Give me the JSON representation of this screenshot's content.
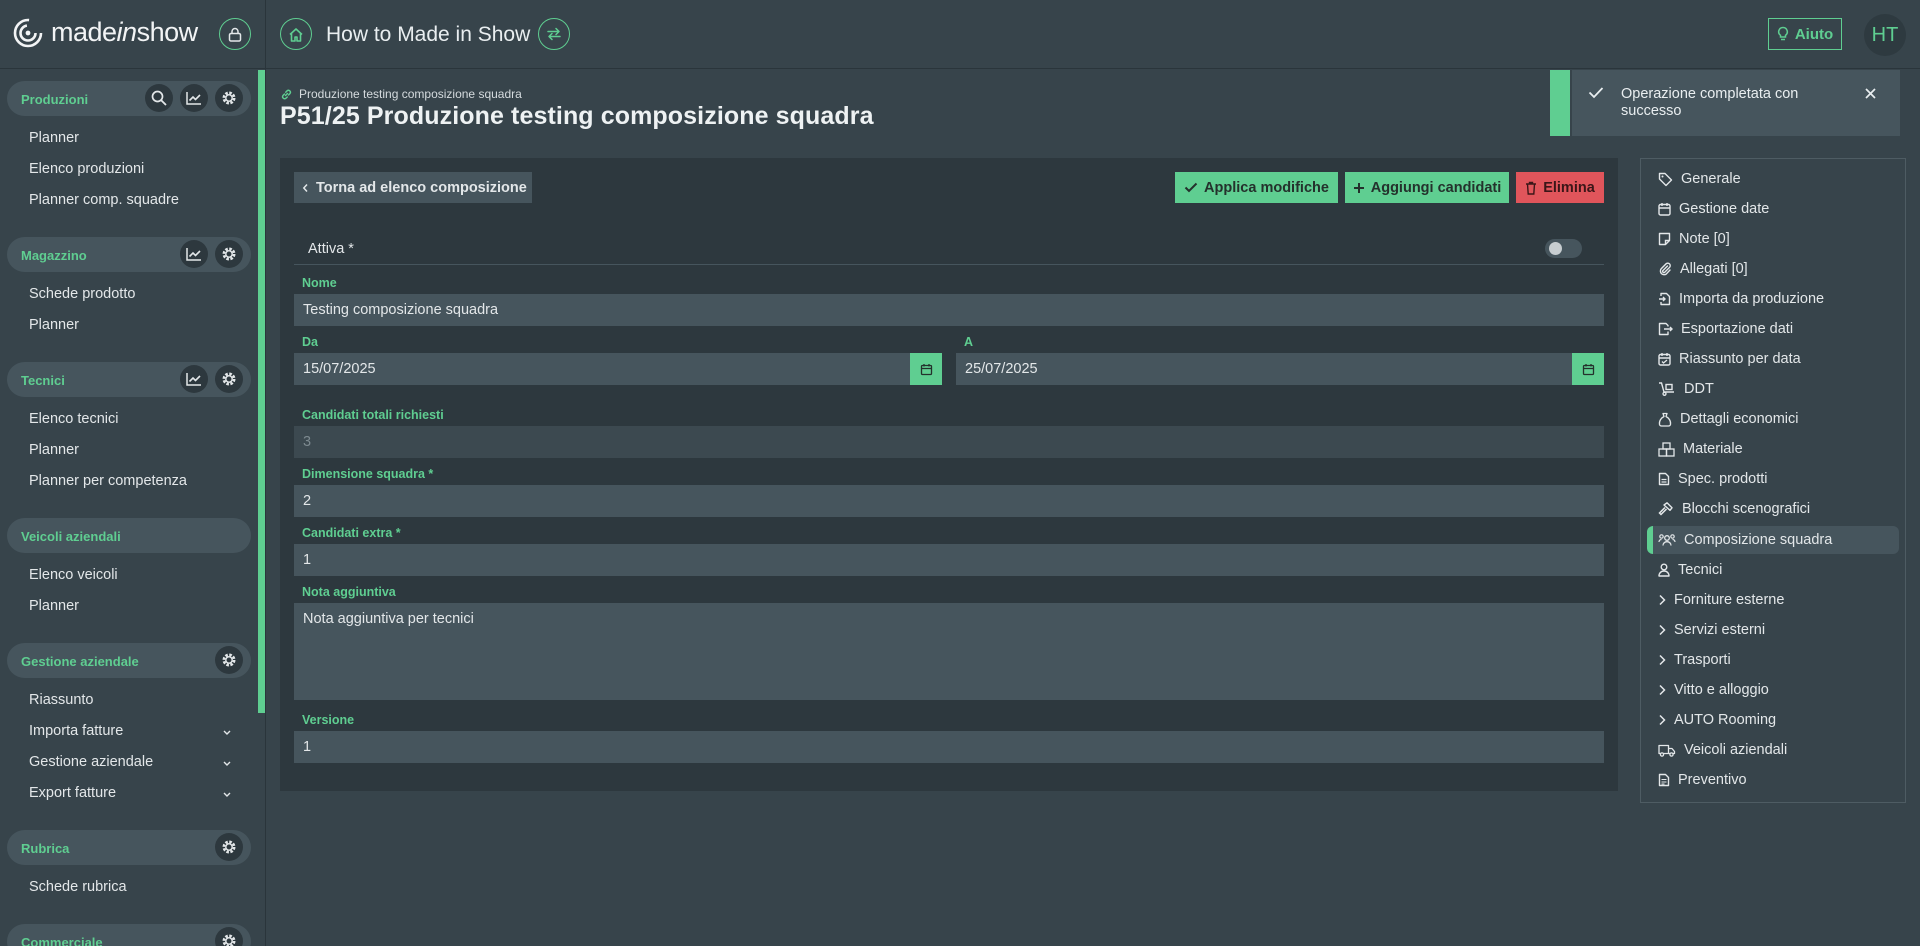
{
  "header": {
    "logo_text": "made in show",
    "logo_part1": "made",
    "logo_part2": "in",
    "logo_part3": "show",
    "page_title": "How to Made in Show",
    "help_label": "Aiuto",
    "avatar_initials": "HT"
  },
  "sidebar": {
    "sections": [
      {
        "title": "Produzioni",
        "items": [
          "Planner",
          "Elenco produzioni",
          "Planner comp. squadre"
        ]
      },
      {
        "title": "Magazzino",
        "items": [
          "Schede prodotto",
          "Planner"
        ]
      },
      {
        "title": "Tecnici",
        "items": [
          "Elenco tecnici",
          "Planner",
          "Planner per competenza"
        ]
      },
      {
        "title": "Veicoli aziendali",
        "items": [
          "Elenco veicoli",
          "Planner"
        ]
      },
      {
        "title": "Gestione aziendale",
        "items": [
          "Riassunto",
          "Importa fatture",
          "Gestione aziendale",
          "Export fatture"
        ]
      },
      {
        "title": "Rubrica",
        "items": [
          "Schede rubrica"
        ]
      },
      {
        "title": "Commerciale",
        "items": []
      }
    ]
  },
  "main": {
    "breadcrumb": "Produzione testing composizione squadra",
    "title": "P51/25 Produzione testing composizione squadra",
    "back_label": "Torna ad elenco composizione",
    "apply_label": "Applica modifiche",
    "add_label": "Aggiungi candidati",
    "delete_label": "Elimina",
    "attiva_label": "Attiva *",
    "attiva_on": false,
    "fields": {
      "nome_label": "Nome",
      "nome_value": "Testing composizione squadra",
      "da_label": "Da",
      "da_value": "15/07/2025",
      "a_label": "A",
      "a_value": "25/07/2025",
      "candidati_totali_label": "Candidati totali richiesti",
      "candidati_totali_value": "3",
      "dimensione_label": "Dimensione squadra *",
      "dimensione_value": "2",
      "extra_label": "Candidati extra *",
      "extra_value": "1",
      "nota_label": "Nota aggiuntiva",
      "nota_value": "Nota aggiuntiva per tecnici",
      "versione_label": "Versione",
      "versione_value": "1"
    }
  },
  "right_menu": {
    "items": [
      {
        "label": "Generale",
        "icon": "tag-icon"
      },
      {
        "label": "Gestione date",
        "icon": "calendar-icon"
      },
      {
        "label": "Note [0]",
        "icon": "note-icon"
      },
      {
        "label": "Allegati [0]",
        "icon": "paperclip-icon"
      },
      {
        "label": "Importa da produzione",
        "icon": "file-import-icon"
      },
      {
        "label": "Esportazione dati",
        "icon": "file-export-icon"
      },
      {
        "label": "Riassunto per data",
        "icon": "calendar-check-icon"
      },
      {
        "label": "DDT",
        "icon": "dolly-icon"
      },
      {
        "label": "Dettagli economici",
        "icon": "money-bag-icon"
      },
      {
        "label": "Materiale",
        "icon": "boxes-icon"
      },
      {
        "label": "Spec. prodotti",
        "icon": "file-text-icon"
      },
      {
        "label": "Blocchi scenografici",
        "icon": "hammer-icon"
      },
      {
        "label": "Composizione squadra",
        "icon": "team-icon",
        "active": true
      },
      {
        "label": "Tecnici",
        "icon": "user-icon"
      },
      {
        "label": "Forniture esterne",
        "icon": "chevron-right-icon"
      },
      {
        "label": "Servizi esterni",
        "icon": "chevron-right-icon"
      },
      {
        "label": "Trasporti",
        "icon": "chevron-right-icon"
      },
      {
        "label": "Vitto e alloggio",
        "icon": "chevron-right-icon"
      },
      {
        "label": "AUTO Rooming",
        "icon": "chevron-right-icon"
      },
      {
        "label": "Veicoli aziendali",
        "icon": "truck-icon"
      },
      {
        "label": "Preventivo",
        "icon": "invoice-icon"
      }
    ]
  },
  "toast": {
    "message": "Operazione completata con successo"
  },
  "colors": {
    "accent": "#5fce91",
    "danger": "#e0555b",
    "background": "#37444b",
    "panel": "#2d383e",
    "field": "#46555d"
  }
}
